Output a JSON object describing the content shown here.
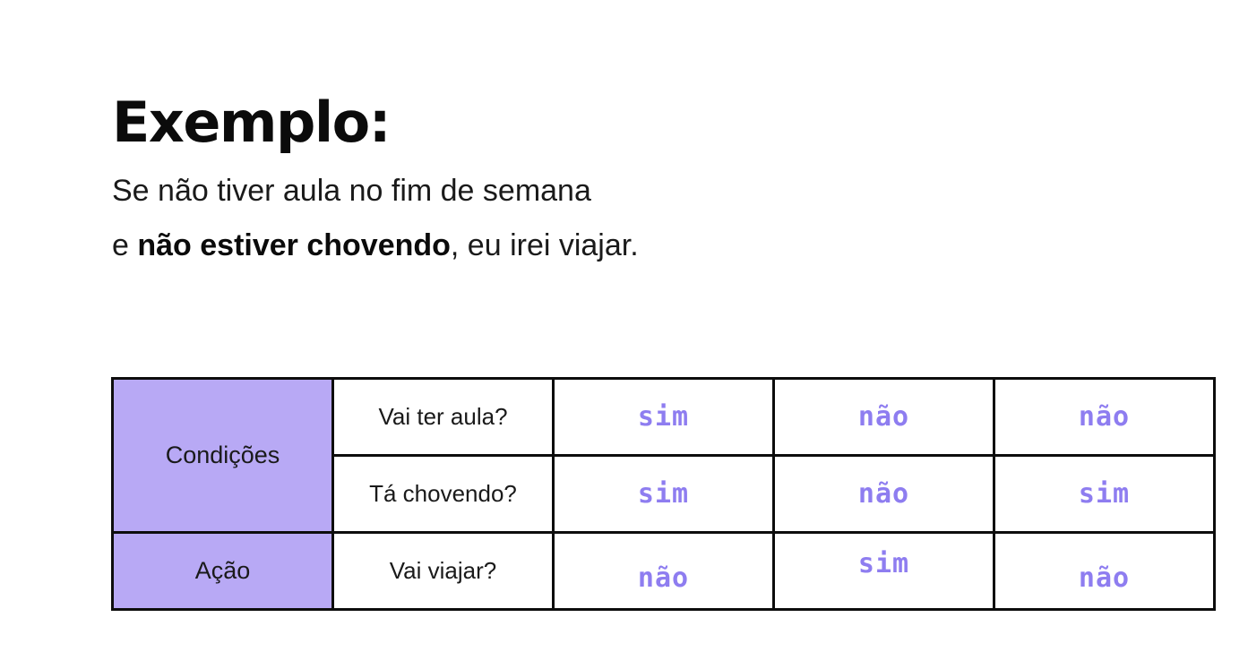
{
  "heading": {
    "title": "Exemplo:",
    "line1": "Se não tiver aula no fim de semana",
    "line2_prefix": "e ",
    "line2_bold": "não estiver chovendo",
    "line2_suffix": ", eu irei viajar."
  },
  "table": {
    "conditions_label": "Condições",
    "action_label": "Ação",
    "rows": [
      {
        "question": "Vai ter aula?",
        "values": [
          "sim",
          "não",
          "não"
        ]
      },
      {
        "question": "Tá chovendo?",
        "values": [
          "sim",
          "não",
          "sim"
        ]
      },
      {
        "question": "Vai viajar?",
        "values": [
          "não",
          "sim",
          "não"
        ]
      }
    ]
  },
  "colors": {
    "header_fill": "#b8a9f5",
    "handwriting": "#8e7df0",
    "border": "#0d0d0d"
  }
}
